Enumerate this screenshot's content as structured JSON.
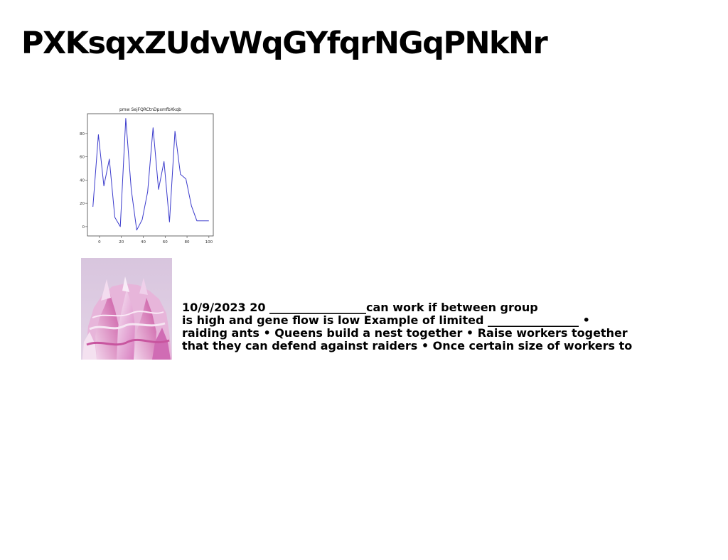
{
  "page": {
    "title": "PXKsqxZUdvWqGYfqrNGqPNkNr",
    "text_lines": [
      "10/9/2023 20 _________________can work if between group",
      "is high and gene flow is low Example of limited ________________ •",
      "raiding ants • Queens build a nest together • Raise workers together",
      "that they can defend against raiders • Once certain size of workers to"
    ]
  },
  "figure": {
    "kind": "photo",
    "subject": "abstract pink and white crystalline sculpture",
    "colors": {
      "background": "#d8c3dc",
      "primary": "#d77fbf",
      "highlight": "#f6eaf6"
    }
  },
  "chart_data": {
    "type": "line",
    "title": "pmw SejFQRCtnDpxmfbXkqb",
    "xlabel": "",
    "ylabel": "",
    "x": [
      -6,
      -1,
      4,
      9,
      14,
      19,
      24,
      29,
      34,
      39,
      44,
      49,
      54,
      59,
      64,
      69,
      74,
      79,
      84,
      89,
      94,
      100
    ],
    "series": [
      {
        "values": [
          17,
          79,
          35,
          58,
          8,
          0,
          93,
          32,
          -3,
          6,
          30,
          85,
          32,
          56,
          4,
          82,
          45,
          41,
          18,
          5,
          5,
          5
        ],
        "color": "#3b3bcc"
      }
    ],
    "xlim": [
      -11,
      104
    ],
    "ylim": [
      -8,
      97
    ],
    "xticks": [
      0,
      20,
      40,
      60,
      80,
      100
    ],
    "yticks": [
      0,
      20,
      40,
      60,
      80
    ],
    "grid": false
  }
}
